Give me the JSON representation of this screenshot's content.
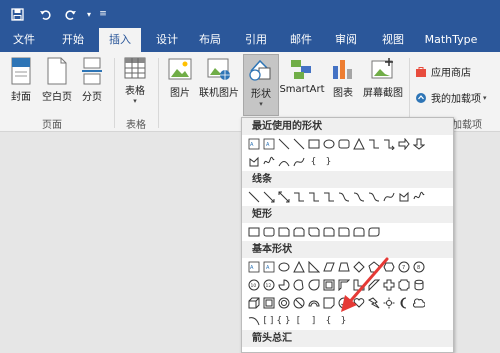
{
  "qat": {
    "save_icon": "save-icon",
    "undo_icon": "undo-icon",
    "redo_icon": "redo-icon"
  },
  "tabs": [
    {
      "label": "文件"
    },
    {
      "label": "开始"
    },
    {
      "label": "插入"
    },
    {
      "label": "设计"
    },
    {
      "label": "布局"
    },
    {
      "label": "引用"
    },
    {
      "label": "邮件"
    },
    {
      "label": "审阅"
    },
    {
      "label": "视图"
    },
    {
      "label": "MathType"
    }
  ],
  "active_tab": "插入",
  "ribbon": {
    "pages": {
      "cover": "封面",
      "blank": "空白页",
      "break": "分页",
      "group": "页面"
    },
    "tables": {
      "table": "表格",
      "group": "表格"
    },
    "illus": {
      "picture": "图片",
      "online": "联机图片",
      "shapes": "形状",
      "smartart": "SmartArt",
      "chart": "图表",
      "screenshot": "屏幕截图"
    },
    "addins": {
      "store": "应用商店",
      "my": "我的加载项",
      "group": "加载项"
    }
  },
  "dropdown": {
    "sections": [
      {
        "title": "最近使用的形状"
      },
      {
        "title": "线条"
      },
      {
        "title": "矩形"
      },
      {
        "title": "基本形状"
      },
      {
        "title": "箭头总汇"
      }
    ]
  },
  "colors": {
    "brand": "#2b579a",
    "arrow": "#e53935"
  }
}
